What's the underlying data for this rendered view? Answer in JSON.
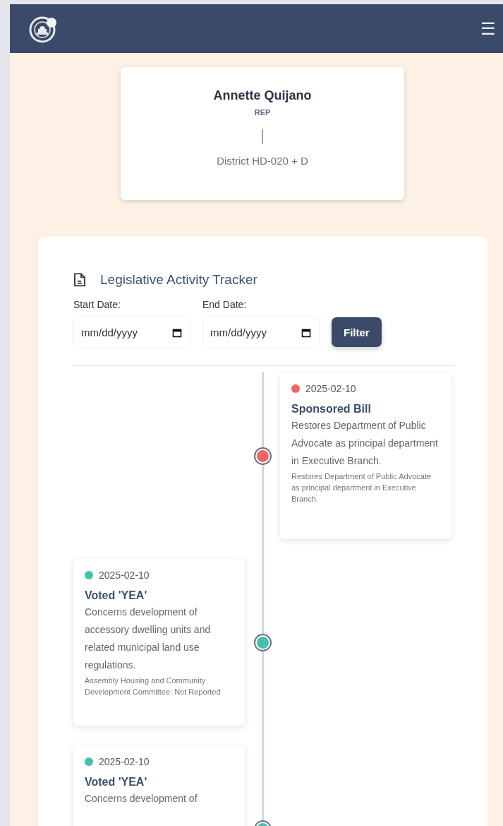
{
  "header": {
    "menu_icon": "☰"
  },
  "profile": {
    "name": "Annette Quijano",
    "role": "REP",
    "separator": "|",
    "district": "District HD-020 + D"
  },
  "tracker": {
    "title": "Legislative Activity Tracker",
    "filters": [
      {
        "label": "Start Date:",
        "placeholder": "mm/dd/yyyy"
      },
      {
        "label": "End Date:",
        "placeholder": "mm/dd/yyyy"
      }
    ],
    "filter_button": "Filter",
    "events": [
      {
        "kind": "right",
        "color": "#f06464",
        "date": "2025-02-10",
        "title": "Sponsored Bill",
        "description": "Restores Department of Public Advocate as principal department in Executive Branch.",
        "note": "Restores Department of Public Advocate as principal department in Executive Branch."
      },
      {
        "kind": "left",
        "color": "#45c1ae",
        "date": "2025-02-10",
        "title": "Voted 'YEA'",
        "description": "Concerns development of accessory dwelling units and related municipal land use regulations.",
        "note": "Assembly Housing and Community Development Committee: Not Reported"
      },
      {
        "kind": "left",
        "color": "#45c1ae",
        "date": "2025-02-10",
        "title": "Voted 'YEA'",
        "description": "Concerns development of"
      }
    ]
  }
}
